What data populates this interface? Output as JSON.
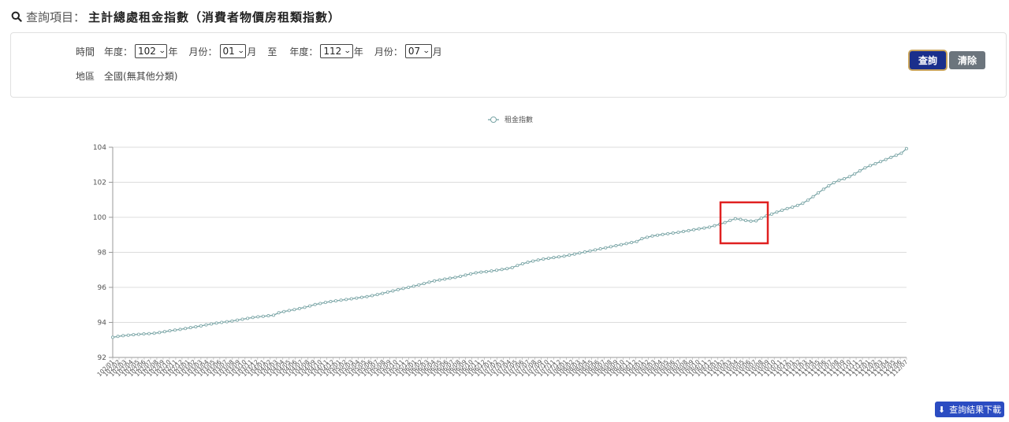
{
  "header": {
    "label": "查詢項目：",
    "value": "主計總處租金指數（消費者物價房租類指數）"
  },
  "filters": {
    "time_label": "時間",
    "year_label": "年度：",
    "month_label": "月份：",
    "year_unit": "年",
    "month_unit": "月",
    "to_label": "至",
    "start_year": "102",
    "start_month": "01",
    "end_year": "112",
    "end_month": "07",
    "region_label": "地區",
    "region_value": "全國(無其他分類)"
  },
  "buttons": {
    "query": "查詢",
    "clear": "清除",
    "download": "查詢結果下載"
  },
  "colors": {
    "line": "#7aa5a6",
    "highlight": "#e02020",
    "grid": "#dcdcdc",
    "primary": "#1a2f8c",
    "secondary": "#6c757d"
  },
  "chart_data": {
    "type": "line",
    "legend": "租金指數",
    "legend_position": "top-center",
    "grid": true,
    "ylim": [
      92,
      104
    ],
    "yticks": [
      92,
      94,
      96,
      98,
      100,
      102,
      104
    ],
    "x_start": "102/01",
    "x_end": "112/07",
    "series": [
      {
        "name": "租金指數",
        "values": [
          93.15,
          93.2,
          93.24,
          93.27,
          93.3,
          93.32,
          93.34,
          93.36,
          93.38,
          93.42,
          93.47,
          93.52,
          93.56,
          93.6,
          93.65,
          93.7,
          93.75,
          93.8,
          93.86,
          93.91,
          93.96,
          94.0,
          94.04,
          94.08,
          94.13,
          94.18,
          94.23,
          94.28,
          94.32,
          94.35,
          94.38,
          94.41,
          94.55,
          94.62,
          94.68,
          94.73,
          94.79,
          94.86,
          94.94,
          95.02,
          95.08,
          95.14,
          95.19,
          95.23,
          95.27,
          95.31,
          95.35,
          95.39,
          95.43,
          95.47,
          95.53,
          95.59,
          95.66,
          95.73,
          95.8,
          95.87,
          95.94,
          96.0,
          96.07,
          96.14,
          96.22,
          96.3,
          96.37,
          96.42,
          96.47,
          96.52,
          96.57,
          96.63,
          96.7,
          96.77,
          96.83,
          96.87,
          96.9,
          96.94,
          96.98,
          97.02,
          97.07,
          97.13,
          97.25,
          97.35,
          97.43,
          97.5,
          97.56,
          97.62,
          97.66,
          97.7,
          97.74,
          97.78,
          97.84,
          97.9,
          97.96,
          98.02,
          98.08,
          98.14,
          98.2,
          98.26,
          98.32,
          98.38,
          98.44,
          98.5,
          98.56,
          98.62,
          98.78,
          98.86,
          98.93,
          98.98,
          99.02,
          99.06,
          99.1,
          99.14,
          99.19,
          99.24,
          99.29,
          99.34,
          99.39,
          99.44,
          99.52,
          99.6,
          99.7,
          99.82,
          99.92,
          99.88,
          99.82,
          99.78,
          99.8,
          99.95,
          100.08,
          100.18,
          100.3,
          100.4,
          100.5,
          100.58,
          100.68,
          100.8,
          100.98,
          101.18,
          101.4,
          101.6,
          101.8,
          101.98,
          102.12,
          102.2,
          102.32,
          102.48,
          102.65,
          102.82,
          102.95,
          103.06,
          103.18,
          103.3,
          103.42,
          103.54,
          103.66,
          103.92
        ]
      }
    ]
  }
}
